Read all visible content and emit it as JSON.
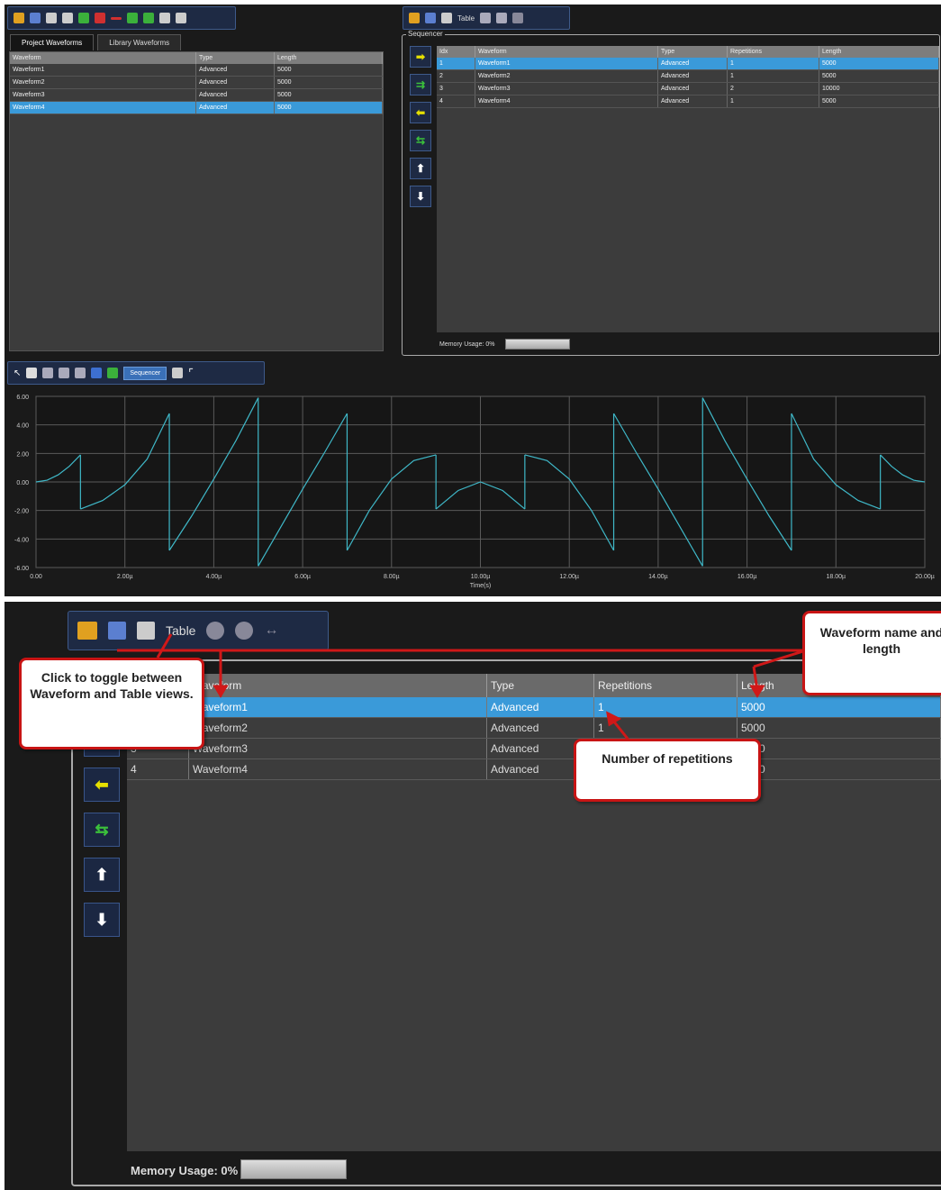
{
  "top": {
    "left_tabs": [
      "Project Waveforms",
      "Library Waveforms"
    ],
    "project_table": {
      "columns": [
        "Waveform",
        "Type",
        "Length"
      ],
      "rows": [
        [
          "Waveform1",
          "Advanced",
          "5000"
        ],
        [
          "Waveform2",
          "Advanced",
          "5000"
        ],
        [
          "Waveform3",
          "Advanced",
          "5000"
        ],
        [
          "Waveform4",
          "Advanced",
          "5000"
        ]
      ]
    },
    "right_toolbar_table_label": "Table",
    "sequencer_label": "Sequencer",
    "sequencer_table": {
      "columns": [
        "Idx",
        "Waveform",
        "Type",
        "Repetitions",
        "Length"
      ],
      "rows": [
        [
          "1",
          "Waveform1",
          "Advanced",
          "1",
          "5000"
        ],
        [
          "2",
          "Waveform2",
          "Advanced",
          "1",
          "5000"
        ],
        [
          "3",
          "Waveform3",
          "Advanced",
          "2",
          "10000"
        ],
        [
          "4",
          "Waveform4",
          "Advanced",
          "1",
          "5000"
        ]
      ]
    },
    "memory_usage": "Memory Usage: 0%",
    "plot_toolbar_label": "Sequencer"
  },
  "chart_data": {
    "type": "line",
    "xlabel": "Time(s)",
    "ylabel": "",
    "title": "",
    "x_ticks": [
      "0.00",
      "2.00µ",
      "4.00µ",
      "6.00µ",
      "8.00µ",
      "10.00µ",
      "12.00µ",
      "14.00µ",
      "16.00µ",
      "18.00µ",
      "20.00µ"
    ],
    "y_ticks": [
      "6.00",
      "4.00",
      "2.00",
      "0.00",
      "-2.00",
      "-4.00",
      "-6.00"
    ],
    "xlim": [
      0,
      20
    ],
    "ylim": [
      -6,
      6
    ],
    "grid": true,
    "color": "#3fb8c8",
    "series": [
      {
        "x": [
          0,
          0.25,
          0.5,
          0.75,
          1.0
        ],
        "y": [
          0,
          0.12,
          0.5,
          1.1,
          1.9
        ]
      },
      {
        "x": [
          1.0,
          1.5,
          2.0,
          2.5,
          3.0
        ],
        "y": [
          -1.9,
          -1.3,
          -0.2,
          1.6,
          4.8
        ]
      },
      {
        "x": [
          3.0,
          3.5,
          4.0,
          4.5,
          5.0
        ],
        "y": [
          -4.8,
          -2.4,
          0.2,
          2.9,
          5.9
        ]
      },
      {
        "x": [
          5.0,
          5.5,
          6.0,
          6.5,
          7.0
        ],
        "y": [
          -5.9,
          -3.2,
          -0.5,
          2.1,
          4.8
        ]
      },
      {
        "x": [
          7.0,
          7.5,
          8.0,
          8.5,
          9.0
        ],
        "y": [
          -4.8,
          -2.0,
          0.2,
          1.5,
          1.9
        ]
      },
      {
        "x": [
          9.0,
          9.5,
          10.0,
          10.5,
          11.0
        ],
        "y": [
          -1.9,
          -0.6,
          0.0,
          -0.6,
          -1.9
        ]
      },
      {
        "x": [
          11.0,
          11.5,
          12.0,
          12.5,
          13.0
        ],
        "y": [
          1.9,
          1.5,
          0.2,
          -2.0,
          -4.8
        ]
      },
      {
        "x": [
          13.0,
          13.5,
          14.0,
          14.5,
          15.0
        ],
        "y": [
          4.8,
          2.1,
          -0.5,
          -3.2,
          -5.9
        ]
      },
      {
        "x": [
          15.0,
          15.5,
          16.0,
          16.5,
          17.0
        ],
        "y": [
          5.9,
          2.9,
          0.2,
          -2.4,
          -4.8
        ]
      },
      {
        "x": [
          17.0,
          17.5,
          18.0,
          18.5,
          19.0
        ],
        "y": [
          4.8,
          1.6,
          -0.2,
          -1.3,
          -1.9
        ]
      },
      {
        "x": [
          19.0,
          19.25,
          19.5,
          19.75,
          20.0
        ],
        "y": [
          1.9,
          1.1,
          0.5,
          0.12,
          0
        ]
      }
    ]
  },
  "bottom": {
    "table_label": "Table",
    "table": {
      "columns": [
        "",
        "Waveform",
        "Type",
        "Repetitions",
        "Length"
      ],
      "rows": [
        [
          "1",
          "Waveform1",
          "Advanced",
          "1",
          "5000"
        ],
        [
          "2",
          "Waveform2",
          "Advanced",
          "1",
          "5000"
        ],
        [
          "3",
          "Waveform3",
          "Advanced",
          "",
          "3000"
        ],
        [
          "4",
          "Waveform4",
          "Advanced",
          "1",
          "5000"
        ]
      ]
    },
    "memory_usage": "Memory Usage: 0%",
    "callouts": {
      "toggle": "Click to toggle between Waveform and Table views.",
      "name_length": "Waveform name and length",
      "repetitions": "Number of repetitions"
    }
  }
}
